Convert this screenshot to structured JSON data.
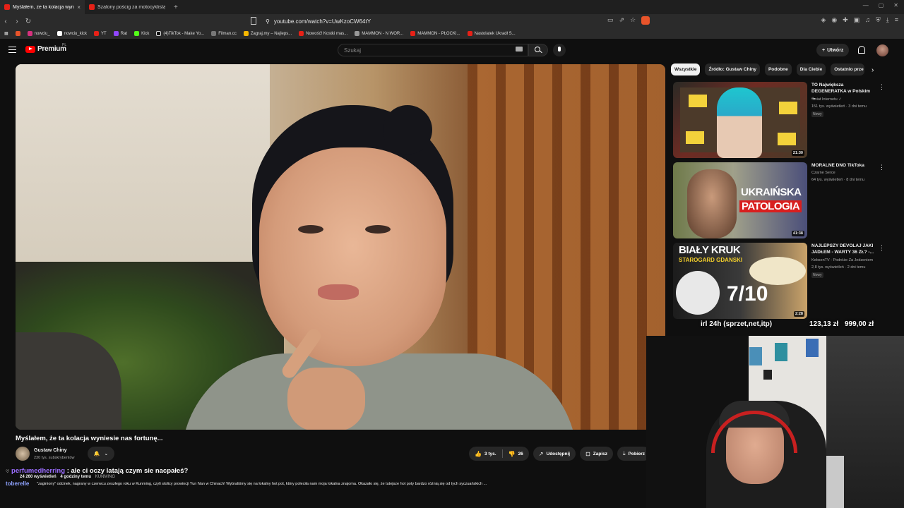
{
  "browser": {
    "tabs": [
      {
        "title": "Myślałem, że ta kolacja wynie...",
        "active": true
      },
      {
        "title": "Szalony pościg za motocyklistą po m...",
        "active": false
      }
    ],
    "url": "youtube.com/watch?v=UwKzoCW64tY",
    "bookmarks": [
      "nowciu_",
      "nowciu_kick",
      "YT",
      "Rat",
      "Kick",
      "(4)TikTok - Make Yo...",
      "Filman.cc",
      "Zagraj.my – Najleps...",
      "Nowość! Kostki mas...",
      "MAMMON - N WOR...",
      "MAMMON - PŁOCKI...",
      "Nastolatek Ukradł S..."
    ]
  },
  "youtube": {
    "logo": "Premium",
    "logo_sup": "PL",
    "search_placeholder": "Szukaj",
    "create_label": "Utwórz"
  },
  "video": {
    "title": "Myślałem, że ta kolacja wyniesie nas fortunę...",
    "channel": "Gustaw Chiny",
    "subscribers": "230 tys. subskrybentów",
    "likes": "3 tys.",
    "dislikes": "26",
    "share_label": "Udostępnij",
    "save_label": "Zapisz",
    "download_label": "Pobierz"
  },
  "description": {
    "views": "24 260 wyświetleń",
    "time": "4 godziny temu",
    "location": "KUNMING",
    "text": "\"zaginiony\" odcinek, nagrany w czerwcu zeszłego roku w Kunming, czyli stolicy prowincji Yun Nan w Chinach! Wybraliśmy się na lokalny hot pot, który poleciła nam moja lokalna znajoma. Okazało się, że tutejsze hot poty bardzo różnią się od tych syczuańskich ..."
  },
  "chat": [
    {
      "user": "perfumedherring",
      "message": ": ale ci oczy latają czym sie nacpałeś?"
    },
    {
      "user": "toberelle",
      "message": ""
    }
  ],
  "chips": [
    "Wszystkie",
    "Źródło: Gustaw Chiny",
    "Podobne",
    "Dla Ciebie",
    "Ostatnio prze"
  ],
  "recommendations": [
    {
      "title": "TO Największa DEGENERATKA w Polskim ...",
      "channel": "Świat Internetu",
      "meta": "151 tys. wyświetleń · 3 dni temu",
      "badge": "Nowy",
      "duration": "21:30"
    },
    {
      "title": "MORALNE DNO TikToka",
      "channel": "Czarne Serce",
      "meta": "64 tys. wyświetleń · 8 dni temu",
      "badge": "",
      "duration": "41:38",
      "thumb_text": [
        "UKRAIŃSKA",
        "PATOLOGIA"
      ]
    },
    {
      "title": "NAJLEPSZY DEVOLAJ JAKI JADŁEM - WARTY 36 ZŁ? -...",
      "channel": "KebsonTV - Podróże Za Jedzeniem",
      "meta": "2,8 tys. wyświetleń · 2 dni temu",
      "badge": "Nowy",
      "duration": "2:28",
      "thumb_text": [
        "BIAŁY KRUK",
        "STAROGARD GDANSKI",
        "7/10"
      ]
    }
  ],
  "overlay": {
    "goal_label": "irl 24h (sprzet,net,itp)",
    "raised": "123,13 zł",
    "target": "999,00 zł"
  }
}
